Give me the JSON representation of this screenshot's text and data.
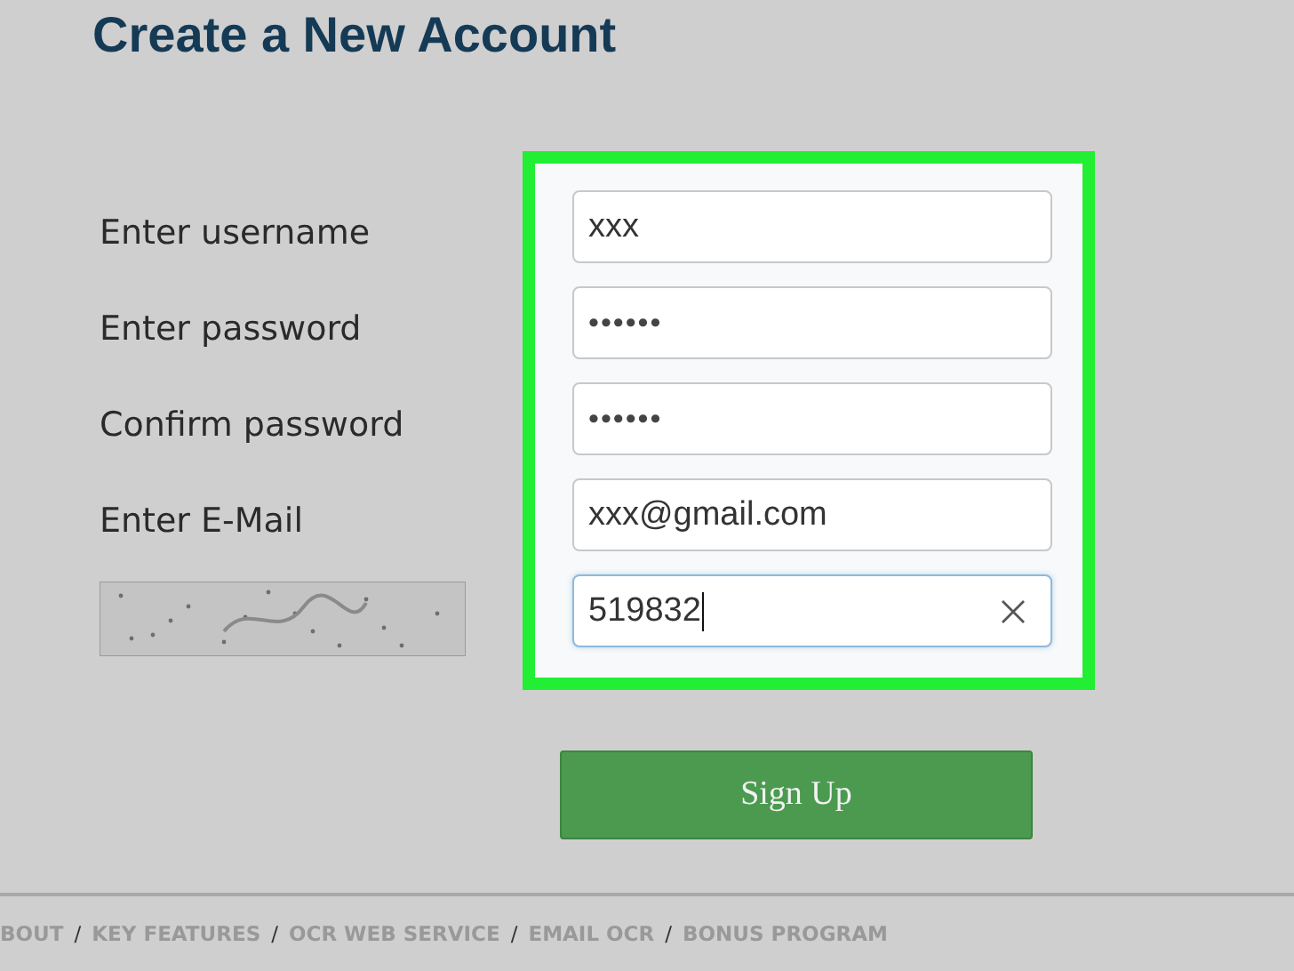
{
  "title": "Create a New Account",
  "fields": [
    {
      "label": "Enter username",
      "kind": "text",
      "value": "xxx",
      "focused": false
    },
    {
      "label": "Enter password",
      "kind": "password",
      "value": "••••••",
      "focused": false
    },
    {
      "label": "Confirm password",
      "kind": "password",
      "value": "••••••",
      "focused": false
    },
    {
      "label": "Enter E-Mail",
      "kind": "text",
      "value": "xxx@gmail.com",
      "focused": false
    },
    {
      "kind": "captcha",
      "value": "519832",
      "focused": true
    }
  ],
  "submit": "Sign Up",
  "footer_links": [
    "BOUT",
    "KEY FEATURES",
    "OCR WEB SERVICE",
    "EMAIL OCR",
    "BONUS PROGRAM"
  ],
  "footer_separator": "/"
}
